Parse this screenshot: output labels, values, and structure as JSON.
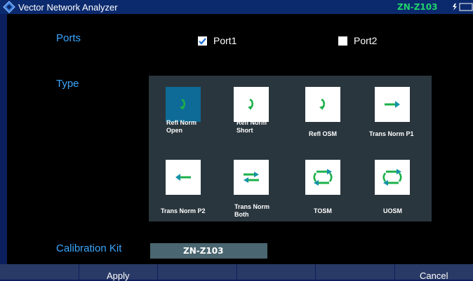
{
  "window": {
    "title": "Vector Network Analyzer",
    "device": "ZN-Z103",
    "logo_icon": "rs-diamond-icon",
    "battery_icon": "battery-charging-icon"
  },
  "ports": {
    "label": "Ports",
    "items": [
      {
        "label": "Port1",
        "checked": true
      },
      {
        "label": "Port2",
        "checked": false
      }
    ]
  },
  "type": {
    "label": "Type",
    "options": [
      {
        "label": "Refl Norm\nOpen",
        "icon": "refl-norm-icon",
        "selected": true
      },
      {
        "label": "Refl Norm\nShort",
        "icon": "refl-norm-icon",
        "selected": false
      },
      {
        "label": "Refl OSM",
        "icon": "refl-osm-icon",
        "selected": false
      },
      {
        "label": "Trans Norm P1",
        "icon": "arrow-right-icon",
        "selected": false
      },
      {
        "label": "Trans Norm P2",
        "icon": "arrow-left-icon",
        "selected": false
      },
      {
        "label": "Trans Norm\nBoth",
        "icon": "arrows-both-icon",
        "selected": false
      },
      {
        "label": "TOSM",
        "icon": "tosm-icon",
        "selected": false
      },
      {
        "label": "UOSM",
        "icon": "uosm-icon",
        "selected": false
      }
    ]
  },
  "calibration_kit": {
    "label": "Calibration Kit",
    "value": "ZN-Z103"
  },
  "softkeys": [
    "",
    "Apply",
    "",
    "",
    "",
    "Cancel"
  ],
  "colors": {
    "accent_blue": "#3aa6ff",
    "device_green": "#1fd36b",
    "icon_green": "#1bb14a",
    "icon_teal": "#1591a8",
    "selected_tile": "#0e6a96"
  }
}
